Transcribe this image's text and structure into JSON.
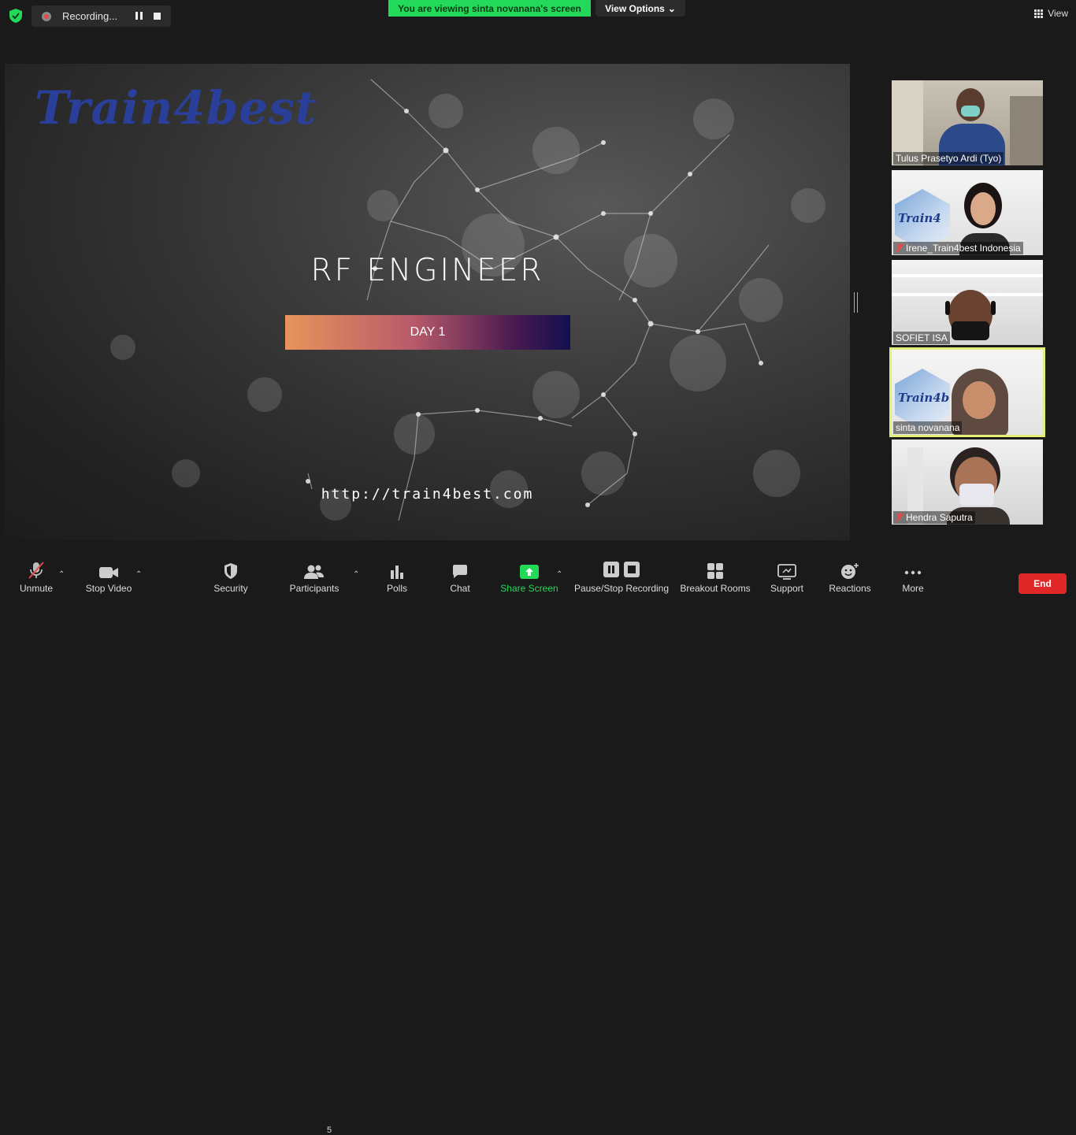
{
  "top": {
    "recording_label": "Recording...",
    "viewing_banner": "You are viewing sinta novanana's screen",
    "view_options_label": "View Options",
    "view_label": "View"
  },
  "slide": {
    "brand": "Train4best",
    "title": "RF ENGINEER",
    "day_label": "DAY 1",
    "url": "http://train4best.com"
  },
  "participants": [
    {
      "name": "Tulus Prasetyo Ardi (Tyo)",
      "muted": false
    },
    {
      "name": "Irene_Train4best Indonesia",
      "muted": true
    },
    {
      "name": "SOFIET ISA",
      "muted": false
    },
    {
      "name": "sinta novanana",
      "muted": false,
      "active_speaker": true
    },
    {
      "name": "Hendra Saputra",
      "muted": true
    }
  ],
  "toolbar": {
    "unmute": "Unmute",
    "stop_video": "Stop Video",
    "security": "Security",
    "participants": "Participants",
    "participants_count": "5",
    "polls": "Polls",
    "chat": "Chat",
    "share_screen": "Share Screen",
    "pause_stop_recording": "Pause/Stop Recording",
    "breakout_rooms": "Breakout Rooms",
    "support": "Support",
    "reactions": "Reactions",
    "more": "More",
    "end": "End"
  },
  "colors": {
    "accent_green": "#23d959",
    "end_red": "#e02828",
    "active_outline": "#e2ef7a",
    "brand_blue": "#2a3f9a"
  }
}
